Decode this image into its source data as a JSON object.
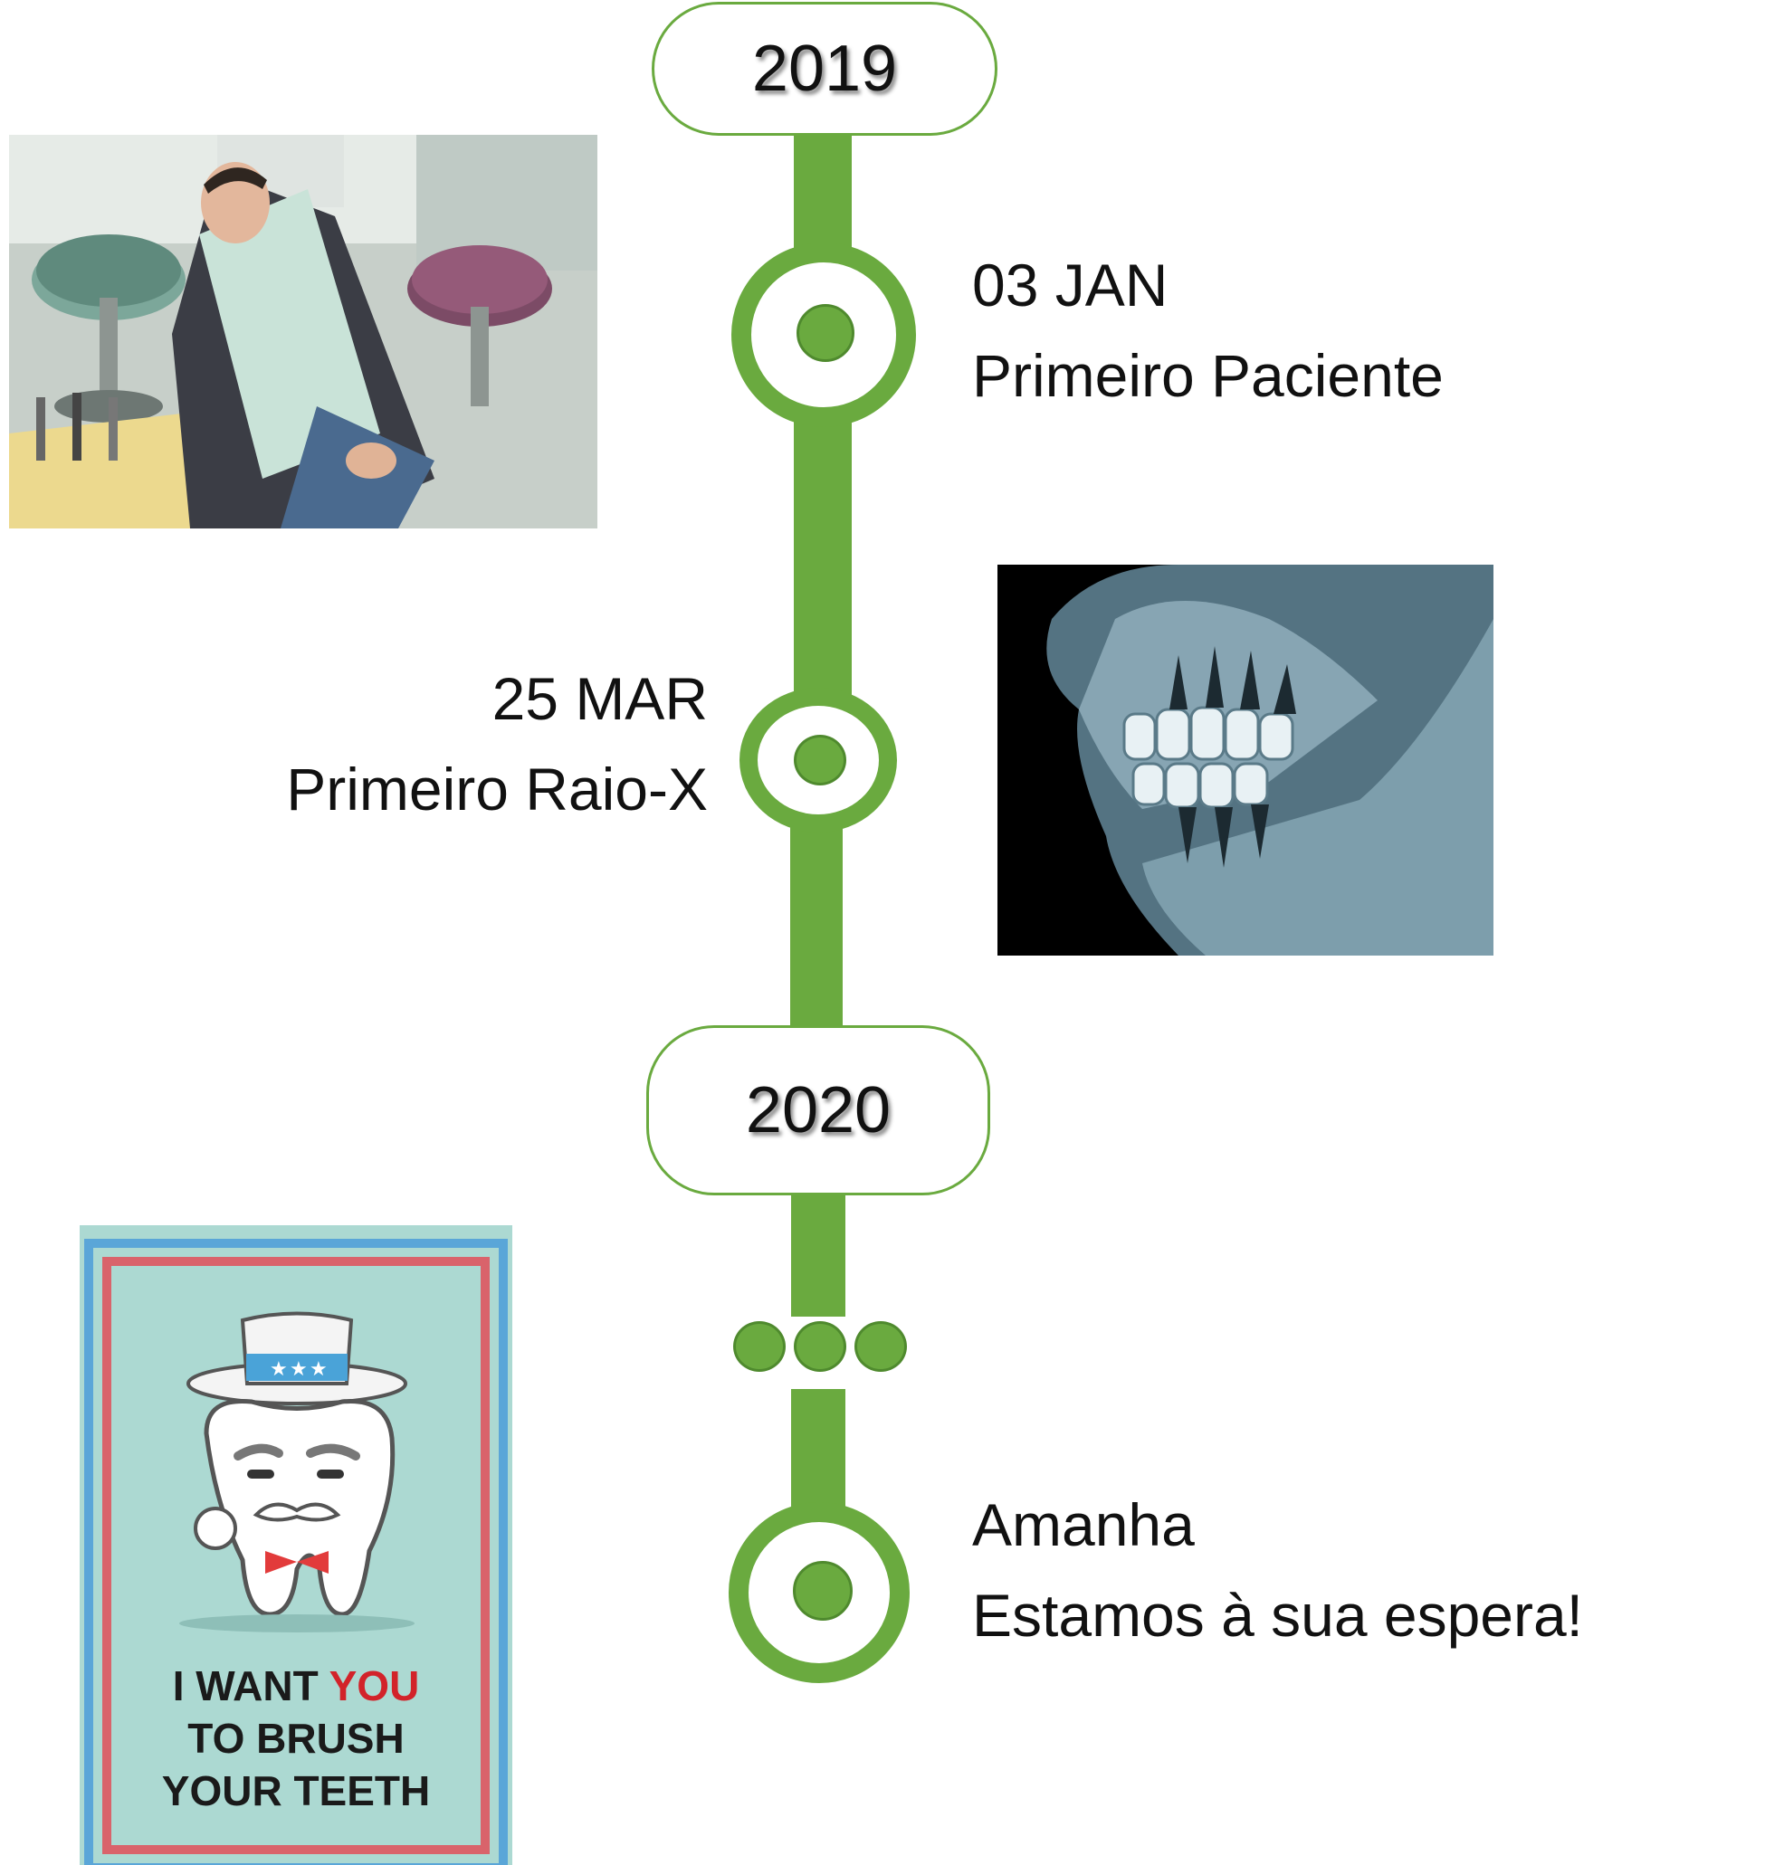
{
  "timeline": {
    "years": [
      {
        "label": "2019"
      },
      {
        "label": "2020"
      }
    ],
    "events": [
      {
        "date": "03 JAN",
        "title": "Primeiro Paciente",
        "image": "dentist-chair-patient-photo"
      },
      {
        "date": "25 MAR",
        "title": "Primeiro Raio-X",
        "image": "dental-xray-image"
      },
      {
        "date": "Amanha",
        "title": "Estamos à sua espera!",
        "image": "tooth-poster-illustration"
      }
    ],
    "ellipsis": "continuation-dots"
  },
  "poster": {
    "line1a": "I WANT ",
    "line1b": "YOU",
    "line2": "TO BRUSH",
    "line3": "YOUR TEETH"
  },
  "colors": {
    "accent_green": "#6aaa3f",
    "poster_bg": "#acd9d2",
    "poster_red": "#d2232a",
    "xray_bg": "#000000"
  }
}
